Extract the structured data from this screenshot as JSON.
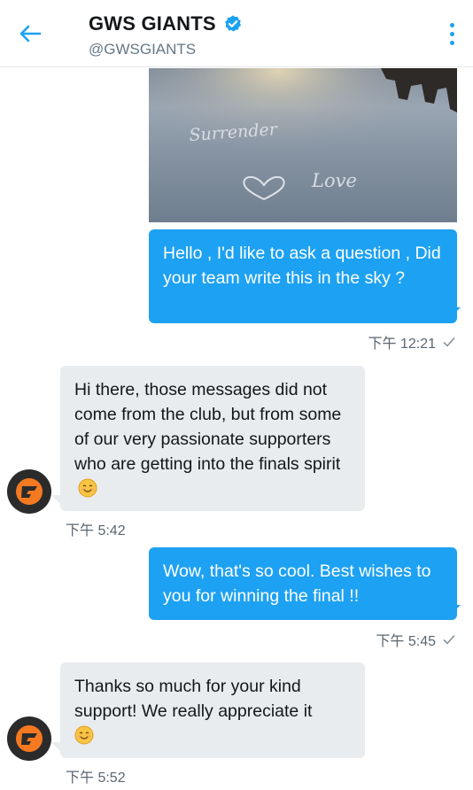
{
  "header": {
    "title": "GWS GIANTS",
    "handle": "@GWSGIANTS",
    "accent_color": "#1da1f2"
  },
  "icons": {
    "back": "arrow-left-icon",
    "verified": "verified-badge-icon",
    "more": "more-vertical-icon",
    "read_receipt": "check-icon",
    "emoji": "smiling-face-icon",
    "avatar": "gws-giants-logo"
  },
  "photo": {
    "sky_text_1": "Surrender",
    "sky_text_2": "Love"
  },
  "messages": [
    {
      "direction": "outgoing",
      "text": "Hello , I'd like to ask a question , Did your team write this in the sky ?",
      "time": "下午 12:21",
      "read": true
    },
    {
      "direction": "incoming",
      "text": "Hi there, those messages did not come from the club, but from some of our very passionate supporters who are getting into the finals spirit",
      "time": "下午 5:42"
    },
    {
      "direction": "outgoing",
      "text": "Wow, that's so cool. Best wishes to you for winning the final !!",
      "time": "下午 5:45",
      "read": true
    },
    {
      "direction": "incoming",
      "text": "Thanks so much for your kind support! We really appreciate it",
      "time": "下午 5:52"
    }
  ]
}
